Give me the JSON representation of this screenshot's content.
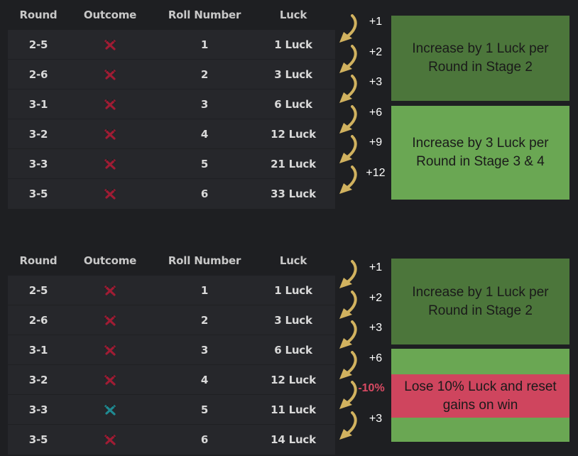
{
  "colors": {
    "background": "#1e1f22",
    "table_bg": "#26272b",
    "loss_icon": "#a01c34",
    "win_icon": "#1f8a92",
    "arrow": "#d1b25f",
    "dark_green": "#4c763b",
    "light_green": "#6aa753",
    "red": "#cf455e",
    "negative_text": "#d94a63"
  },
  "tables": [
    {
      "headers": [
        "Round",
        "Outcome",
        "Roll Number",
        "Luck"
      ],
      "rows": [
        {
          "round": "2-5",
          "outcome": "loss",
          "outcome_icon": "crossed-swords-loss-icon",
          "roll": "1",
          "luck": "1 Luck"
        },
        {
          "round": "2-6",
          "outcome": "loss",
          "outcome_icon": "crossed-swords-loss-icon",
          "roll": "2",
          "luck": "3 Luck"
        },
        {
          "round": "3-1",
          "outcome": "loss",
          "outcome_icon": "crossed-swords-loss-icon",
          "roll": "3",
          "luck": "6 Luck"
        },
        {
          "round": "3-2",
          "outcome": "loss",
          "outcome_icon": "crossed-swords-loss-icon",
          "roll": "4",
          "luck": "12 Luck"
        },
        {
          "round": "3-3",
          "outcome": "loss",
          "outcome_icon": "crossed-swords-loss-icon",
          "roll": "5",
          "luck": "21 Luck"
        },
        {
          "round": "3-5",
          "outcome": "loss",
          "outcome_icon": "crossed-swords-loss-icon",
          "roll": "6",
          "luck": "33 Luck"
        }
      ],
      "increments": [
        "+1",
        "+2",
        "+3",
        "+6",
        "+9",
        "+12"
      ],
      "notes": [
        {
          "text": "Increase by 1 Luck per Round in Stage 2",
          "color": "dark-green"
        },
        {
          "text": "Increase by 3 Luck per Round in Stage 3 & 4",
          "color": "light-green"
        }
      ]
    },
    {
      "headers": [
        "Round",
        "Outcome",
        "Roll Number",
        "Luck"
      ],
      "rows": [
        {
          "round": "2-5",
          "outcome": "loss",
          "outcome_icon": "crossed-swords-loss-icon",
          "roll": "1",
          "luck": "1 Luck"
        },
        {
          "round": "2-6",
          "outcome": "loss",
          "outcome_icon": "crossed-swords-loss-icon",
          "roll": "2",
          "luck": "3 Luck"
        },
        {
          "round": "3-1",
          "outcome": "loss",
          "outcome_icon": "crossed-swords-loss-icon",
          "roll": "3",
          "luck": "6 Luck"
        },
        {
          "round": "3-2",
          "outcome": "loss",
          "outcome_icon": "crossed-swords-loss-icon",
          "roll": "4",
          "luck": "12 Luck"
        },
        {
          "round": "3-3",
          "outcome": "win",
          "outcome_icon": "crossed-swords-win-icon",
          "roll": "5",
          "luck": "11 Luck"
        },
        {
          "round": "3-5",
          "outcome": "loss",
          "outcome_icon": "crossed-swords-loss-icon",
          "roll": "6",
          "luck": "14 Luck"
        }
      ],
      "increments": [
        "+1",
        "+2",
        "+3",
        "+6",
        "-10%",
        "+3"
      ],
      "notes": [
        {
          "text": "Increase by 1 Luck per Round in Stage 2",
          "color": "dark-green"
        },
        {
          "text": "Lose 10% Luck and reset gains on win",
          "color": "red"
        }
      ]
    }
  ]
}
